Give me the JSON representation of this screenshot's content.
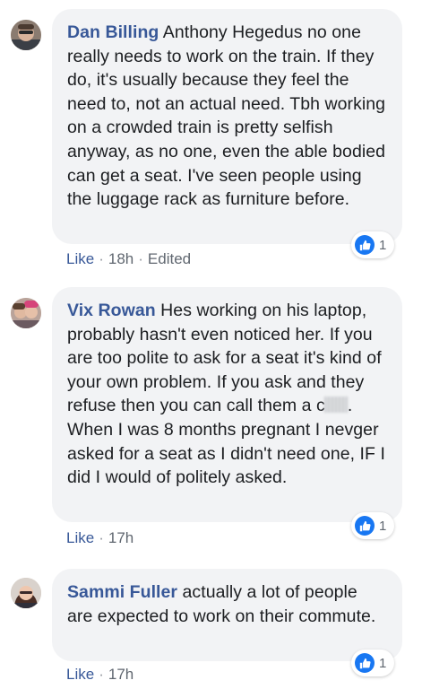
{
  "comments": [
    {
      "author": "Dan Billing",
      "text": " Anthony Hegedus no one really needs to work on the train. If they do, it's usually because they feel the need to, not an actual need. Tbh working on a crowded train is pretty selfish anyway, as no one, even the able bodied can get a seat. I've seen people using the luggage rack as furniture before.",
      "like_label": "Like",
      "time": "18h",
      "edited_label": "Edited",
      "reaction_count": "1"
    },
    {
      "author": "Vix Rowan",
      "text_part1": " Hes working on his laptop, probably hasn't even noticed her. If you are too polite to ask for a seat it's kind of your own problem. If you ask and they refuse then you can call them a c",
      "text_part2": ". When I was 8 months pregnant I nevger asked for a seat as I didn't need one, IF I did I would of politely asked.",
      "like_label": "Like",
      "time": "17h",
      "reaction_count": "1"
    },
    {
      "author": "Sammi Fuller",
      "text": " actually a lot of people are expected to work on their commute.",
      "like_label": "Like",
      "time": "17h",
      "reaction_count": "1"
    }
  ],
  "separator": "·",
  "colors": {
    "author": "#385898",
    "bubble": "#f2f3f5",
    "like_reaction": "#1877f2",
    "meta": "#606770"
  },
  "icons": {
    "reaction": "thumbs-up-icon"
  }
}
